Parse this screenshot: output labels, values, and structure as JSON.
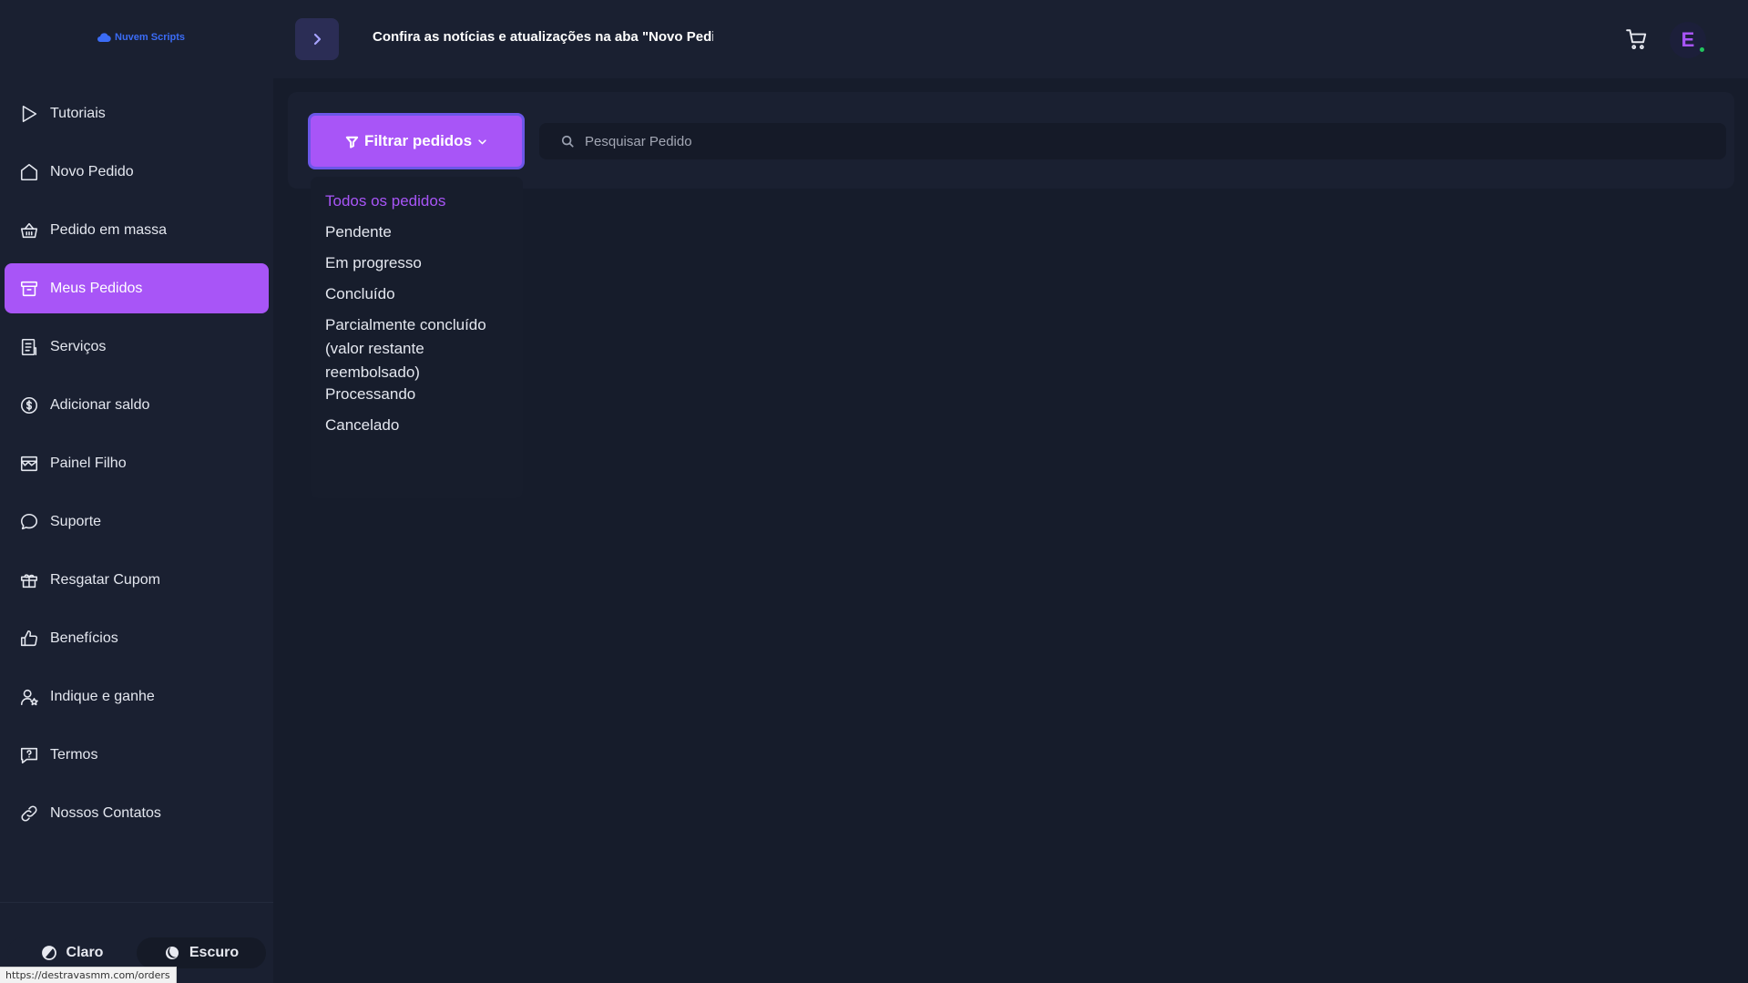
{
  "app": {
    "logo_text": "Nuvem Scripts",
    "brand_color": "#a855f7"
  },
  "header": {
    "announcement": "Confira as notícias e atualizações na aba \"Novo Pedid",
    "avatar_letter": "E",
    "cart_icon": "cart-icon"
  },
  "sidebar": {
    "items": [
      {
        "label": "Tutoriais",
        "icon": "play-icon",
        "active": false
      },
      {
        "label": "Novo Pedido",
        "icon": "home-icon",
        "active": false
      },
      {
        "label": "Pedido em massa",
        "icon": "basket-icon",
        "active": false
      },
      {
        "label": "Meus Pedidos",
        "icon": "archive-icon",
        "active": true
      },
      {
        "label": "Serviços",
        "icon": "list-icon",
        "active": false
      },
      {
        "label": "Adicionar saldo",
        "icon": "coin-icon",
        "active": false
      },
      {
        "label": "Painel Filho",
        "icon": "store-icon",
        "active": false
      },
      {
        "label": "Suporte",
        "icon": "chat-icon",
        "active": false
      },
      {
        "label": "Resgatar Cupom",
        "icon": "gift-icon",
        "active": false
      },
      {
        "label": "Benefícios",
        "icon": "thumbs-up-icon",
        "active": false
      },
      {
        "label": "Indique e ganhe",
        "icon": "user-star-icon",
        "active": false
      },
      {
        "label": "Termos",
        "icon": "help-message-icon",
        "active": false
      },
      {
        "label": "Nossos Contatos",
        "icon": "link-icon",
        "active": false
      }
    ],
    "theme": {
      "light_label": "Claro",
      "dark_label": "Escuro",
      "selected": "Escuro"
    }
  },
  "filter": {
    "button_label": "Filtrar pedidos",
    "search_placeholder": "Pesquisar Pedido",
    "options": [
      "Todos os pedidos",
      "Pendente",
      "Em progresso",
      "Concluído",
      "Parcialmente concluído (valor restante reembolsado)",
      "Processando",
      "Cancelado"
    ],
    "selected_option": "Todos os pedidos"
  },
  "status_bar": {
    "url": "https://destravasmm.com/orders"
  }
}
